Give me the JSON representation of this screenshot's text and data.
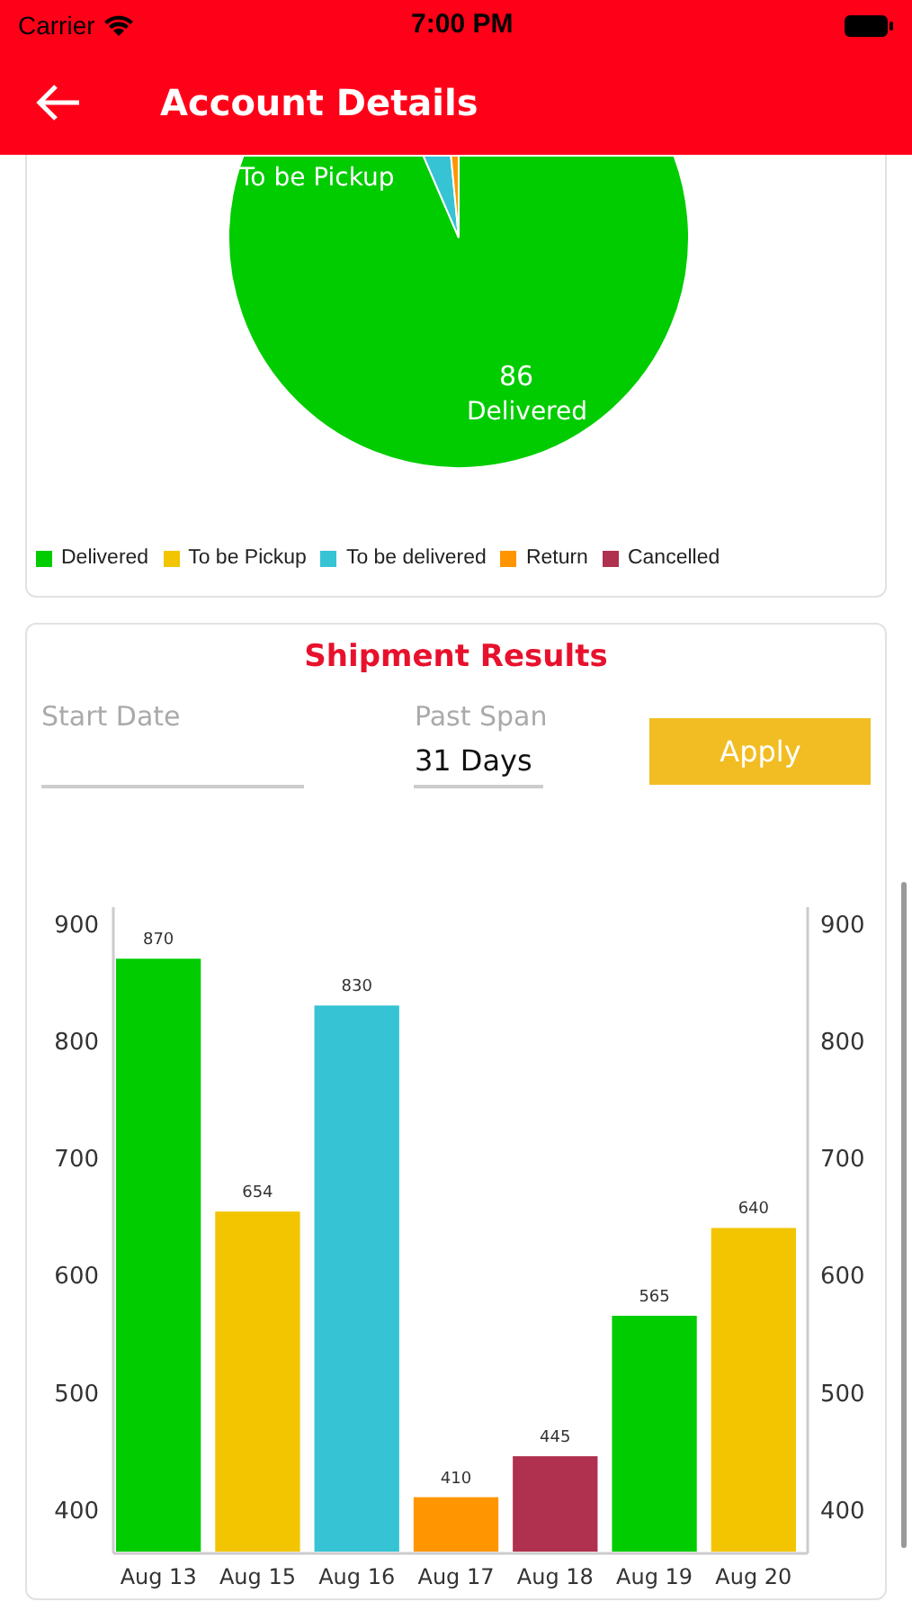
{
  "status_bar": {
    "carrier": "Carrier",
    "time": "7:00 PM"
  },
  "header": {
    "title": "Account Details"
  },
  "pie": {
    "labels": [
      {
        "text": "To be Pickup"
      },
      {
        "text": "86"
      },
      {
        "text": "Delivered"
      }
    ],
    "legend": [
      {
        "label": "Delivered",
        "color": "#00cc00"
      },
      {
        "label": "To be Pickup",
        "color": "#f2c500"
      },
      {
        "label": "To be delivered",
        "color": "#36c3d4"
      },
      {
        "label": "Return",
        "color": "#ff9500"
      },
      {
        "label": "Cancelled",
        "color": "#b0304f"
      }
    ]
  },
  "shipment": {
    "title": "Shipment Results",
    "start_date": {
      "label": "Start Date"
    },
    "past_span": {
      "label": "Past Span",
      "value": "31 Days"
    },
    "apply": "Apply",
    "chart_data": {
      "type": "bar",
      "categories": [
        "Aug 13",
        "Aug 15",
        "Aug 16",
        "Aug 17",
        "Aug 18",
        "Aug 19",
        "Aug 20"
      ],
      "series": [
        {
          "color": "#00cc00",
          "values": [
            870,
            null,
            null,
            null,
            null,
            565,
            null
          ]
        },
        {
          "color": "#f2c500",
          "values": [
            null,
            654,
            null,
            null,
            null,
            null,
            640
          ]
        },
        {
          "color": "#36c3d4",
          "values": [
            null,
            null,
            830,
            null,
            null,
            null,
            null
          ]
        },
        {
          "color": "#ff9500",
          "values": [
            null,
            null,
            null,
            410,
            null,
            null,
            null
          ]
        },
        {
          "color": "#b0304f",
          "values": [
            null,
            null,
            null,
            null,
            445,
            null,
            null
          ]
        }
      ],
      "ylim": [
        362,
        914
      ],
      "yticks": [
        400,
        500,
        600,
        700,
        800,
        900
      ],
      "data_labels": true
    },
    "right_axis_ticks": [
      "900",
      "800",
      "700",
      "600",
      "500",
      "400"
    ]
  }
}
